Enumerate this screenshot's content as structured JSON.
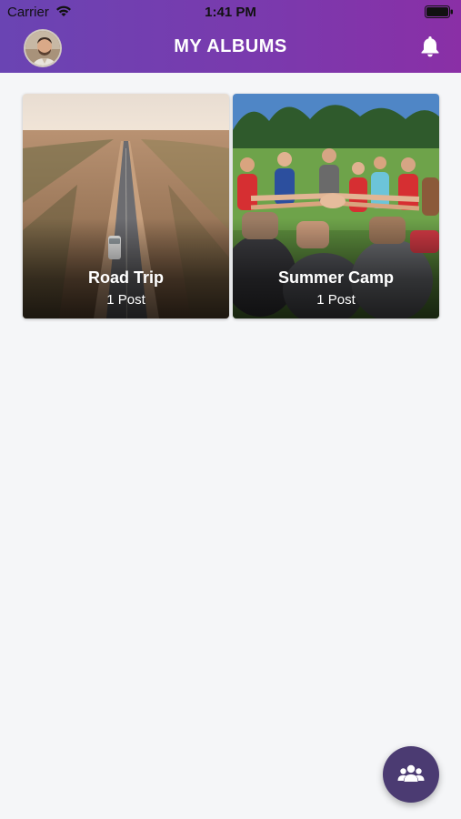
{
  "status_bar": {
    "carrier": "Carrier",
    "time": "1:41 PM",
    "wifi_icon": "wifi-icon",
    "battery_icon": "battery-icon"
  },
  "header": {
    "title": "MY ALBUMS",
    "avatar_icon": "user-avatar",
    "bell_icon": "bell-icon",
    "gradient_start": "#6a44b3",
    "gradient_end": "#8a2fa6"
  },
  "albums": [
    {
      "title": "Road Trip",
      "count": "1 Post"
    },
    {
      "title": "Summer Camp",
      "count": "1 Post"
    }
  ],
  "fab": {
    "icon": "group-icon",
    "color": "#4b3b72"
  }
}
